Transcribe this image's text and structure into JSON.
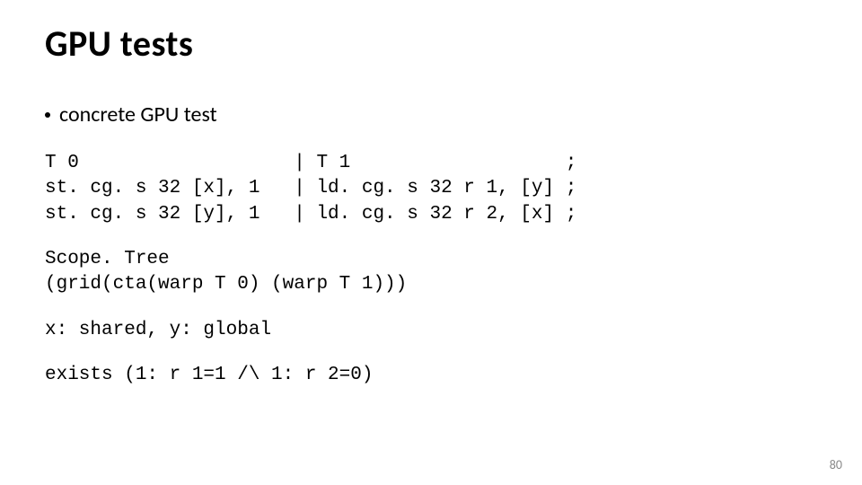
{
  "title": "GPU tests",
  "bullet": "concrete GPU test",
  "code_block_1": "T 0                   | T 1                   ;\nst. cg. s 32 [x], 1   | ld. cg. s 32 r 1, [y] ;\nst. cg. s 32 [y], 1   | ld. cg. s 32 r 2, [x] ;",
  "code_block_2": "Scope. Tree\n(grid(cta(warp T 0) (warp T 1)))",
  "code_block_3": "x: shared, y: global",
  "code_block_4": "exists (1: r 1=1 /\\ 1: r 2=0)",
  "page_number": "80"
}
